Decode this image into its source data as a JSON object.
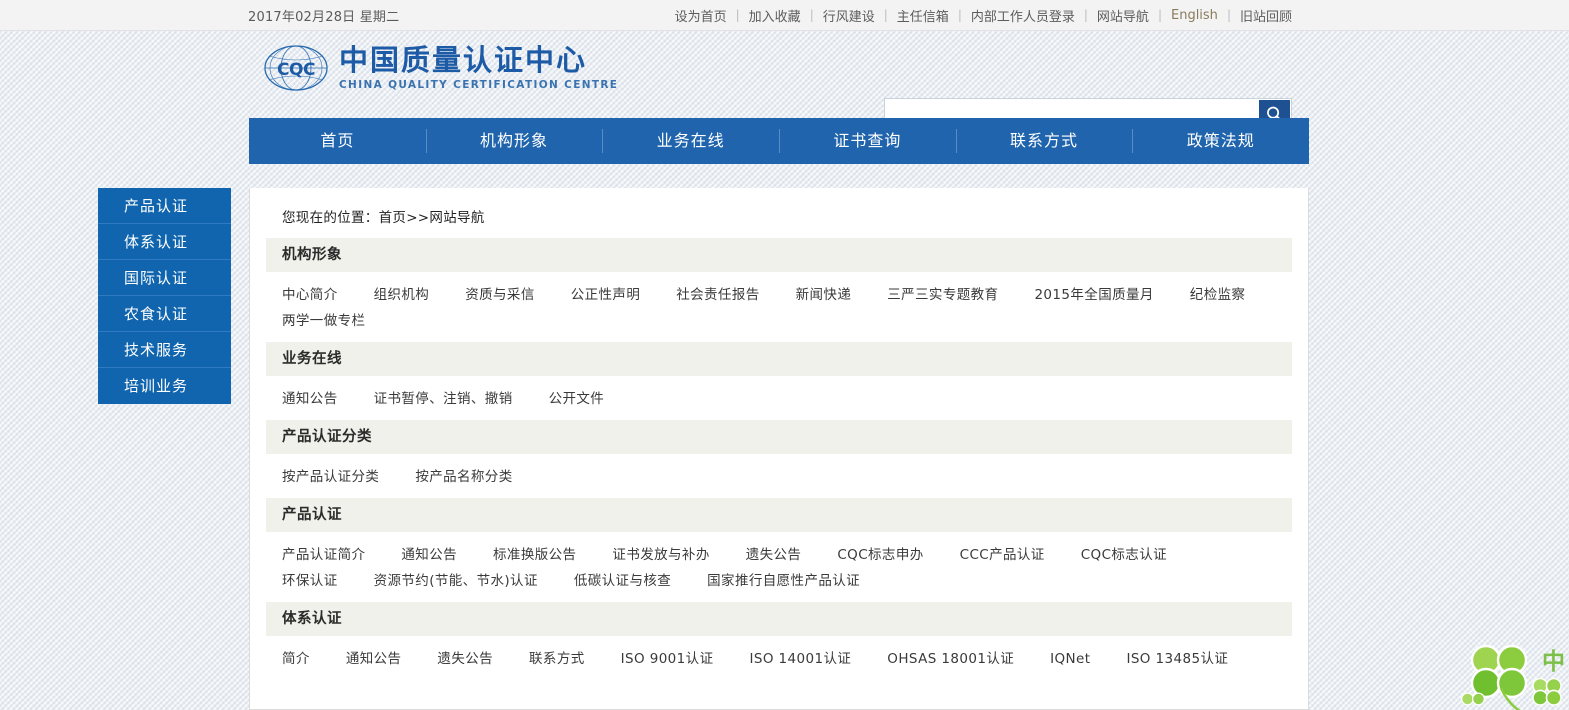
{
  "topbar": {
    "date": "2017年02月28日 星期二",
    "links": [
      {
        "label": "设为首页",
        "accent": false
      },
      {
        "label": "加入收藏",
        "accent": false
      },
      {
        "label": "行风建设",
        "accent": false
      },
      {
        "label": "主任信箱",
        "accent": false
      },
      {
        "label": "内部工作人员登录",
        "accent": false
      },
      {
        "label": "网站导航",
        "accent": false
      },
      {
        "label": "English",
        "accent": true
      },
      {
        "label": "旧站回顾",
        "accent": false
      }
    ],
    "separator": "|"
  },
  "logo": {
    "mark_text": "CQC",
    "title_cn": "中国质量认证中心",
    "title_en": "CHINA QUALITY CERTIFICATION CENTRE"
  },
  "search": {
    "value": "",
    "placeholder": "",
    "icon": "search-icon"
  },
  "mainnav": {
    "items": [
      {
        "label": "首页"
      },
      {
        "label": "机构形象"
      },
      {
        "label": "业务在线"
      },
      {
        "label": "证书查询"
      },
      {
        "label": "联系方式"
      },
      {
        "label": "政策法规"
      }
    ]
  },
  "sidebar": {
    "items": [
      {
        "label": "产品认证"
      },
      {
        "label": "体系认证"
      },
      {
        "label": "国际认证"
      },
      {
        "label": "农食认证"
      },
      {
        "label": "技术服务"
      },
      {
        "label": "培训业务"
      }
    ]
  },
  "content": {
    "breadcrumb": "您现在的位置：首页>>网站导航",
    "sections": [
      {
        "title": "机构形象",
        "links": [
          "中心简介",
          "组织机构",
          "资质与采信",
          "公正性声明",
          "社会责任报告",
          "新闻快递",
          "三严三实专题教育",
          "2015年全国质量月",
          "纪检监察",
          "两学一做专栏"
        ]
      },
      {
        "title": "业务在线",
        "links": [
          "通知公告",
          "证书暂停、注销、撤销",
          "公开文件"
        ]
      },
      {
        "title": "产品认证分类",
        "links": [
          "按产品认证分类",
          "按产品名称分类"
        ]
      },
      {
        "title": "产品认证",
        "links": [
          "产品认证简介",
          "通知公告",
          "标准换版公告",
          "证书发放与补办",
          "遗失公告",
          "CQC标志申办",
          "CCC产品认证",
          "CQC标志认证",
          "环保认证",
          "资源节约(节能、节水)认证",
          "低碳认证与核查",
          "国家推行自愿性产品认证"
        ]
      },
      {
        "title": "体系认证",
        "links": [
          "简介",
          "通知公告",
          "遗失公告",
          "联系方式",
          "ISO 9001认证",
          "ISO 14001认证",
          "OHSAS 18001认证",
          "IQNet",
          "ISO 13485认证"
        ]
      }
    ]
  },
  "decoration": {
    "corner_character": "中"
  },
  "colors": {
    "nav_blue": "#1f64ad",
    "sidebar_blue": "#1065ae",
    "logo_blue": "#1d5ba6",
    "search_btn": "#1d5191",
    "section_head_bg": "#f0f1ea",
    "accent_link": "#8a7b5c",
    "clover_green": "#7cc04a"
  }
}
